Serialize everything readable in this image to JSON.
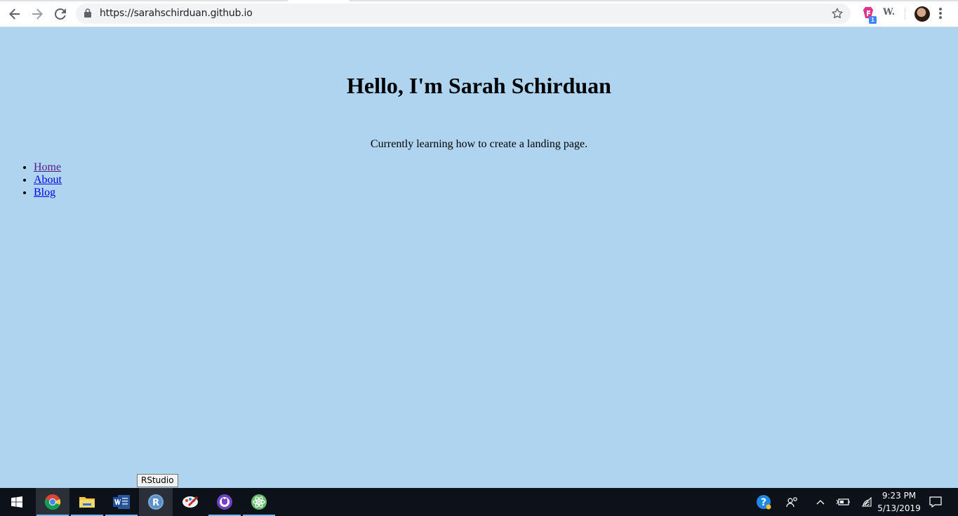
{
  "browser": {
    "url": "https://sarahschirduan.github.io",
    "icons": [
      "back-icon",
      "forward-icon",
      "reload-icon",
      "lock-icon",
      "star-icon",
      "extension-icon",
      "profile-avatar",
      "menu-icon"
    ],
    "extension_badge": "1",
    "extension_w_label": "W."
  },
  "page": {
    "title": "Hello, I'm Sarah Schirduan",
    "subtitle": "Currently learning how to create a landing page.",
    "nav": [
      {
        "label": "Home"
      },
      {
        "label": "About"
      },
      {
        "label": "Blog"
      }
    ],
    "background_color": "#aed4ef"
  },
  "taskbar": {
    "tooltip": "RStudio",
    "apps": [
      "windows-start",
      "chrome",
      "file-explorer",
      "word",
      "rstudio",
      "paint-app",
      "github-desktop",
      "atom"
    ],
    "time": "9:23 PM",
    "date": "5/13/2019"
  }
}
